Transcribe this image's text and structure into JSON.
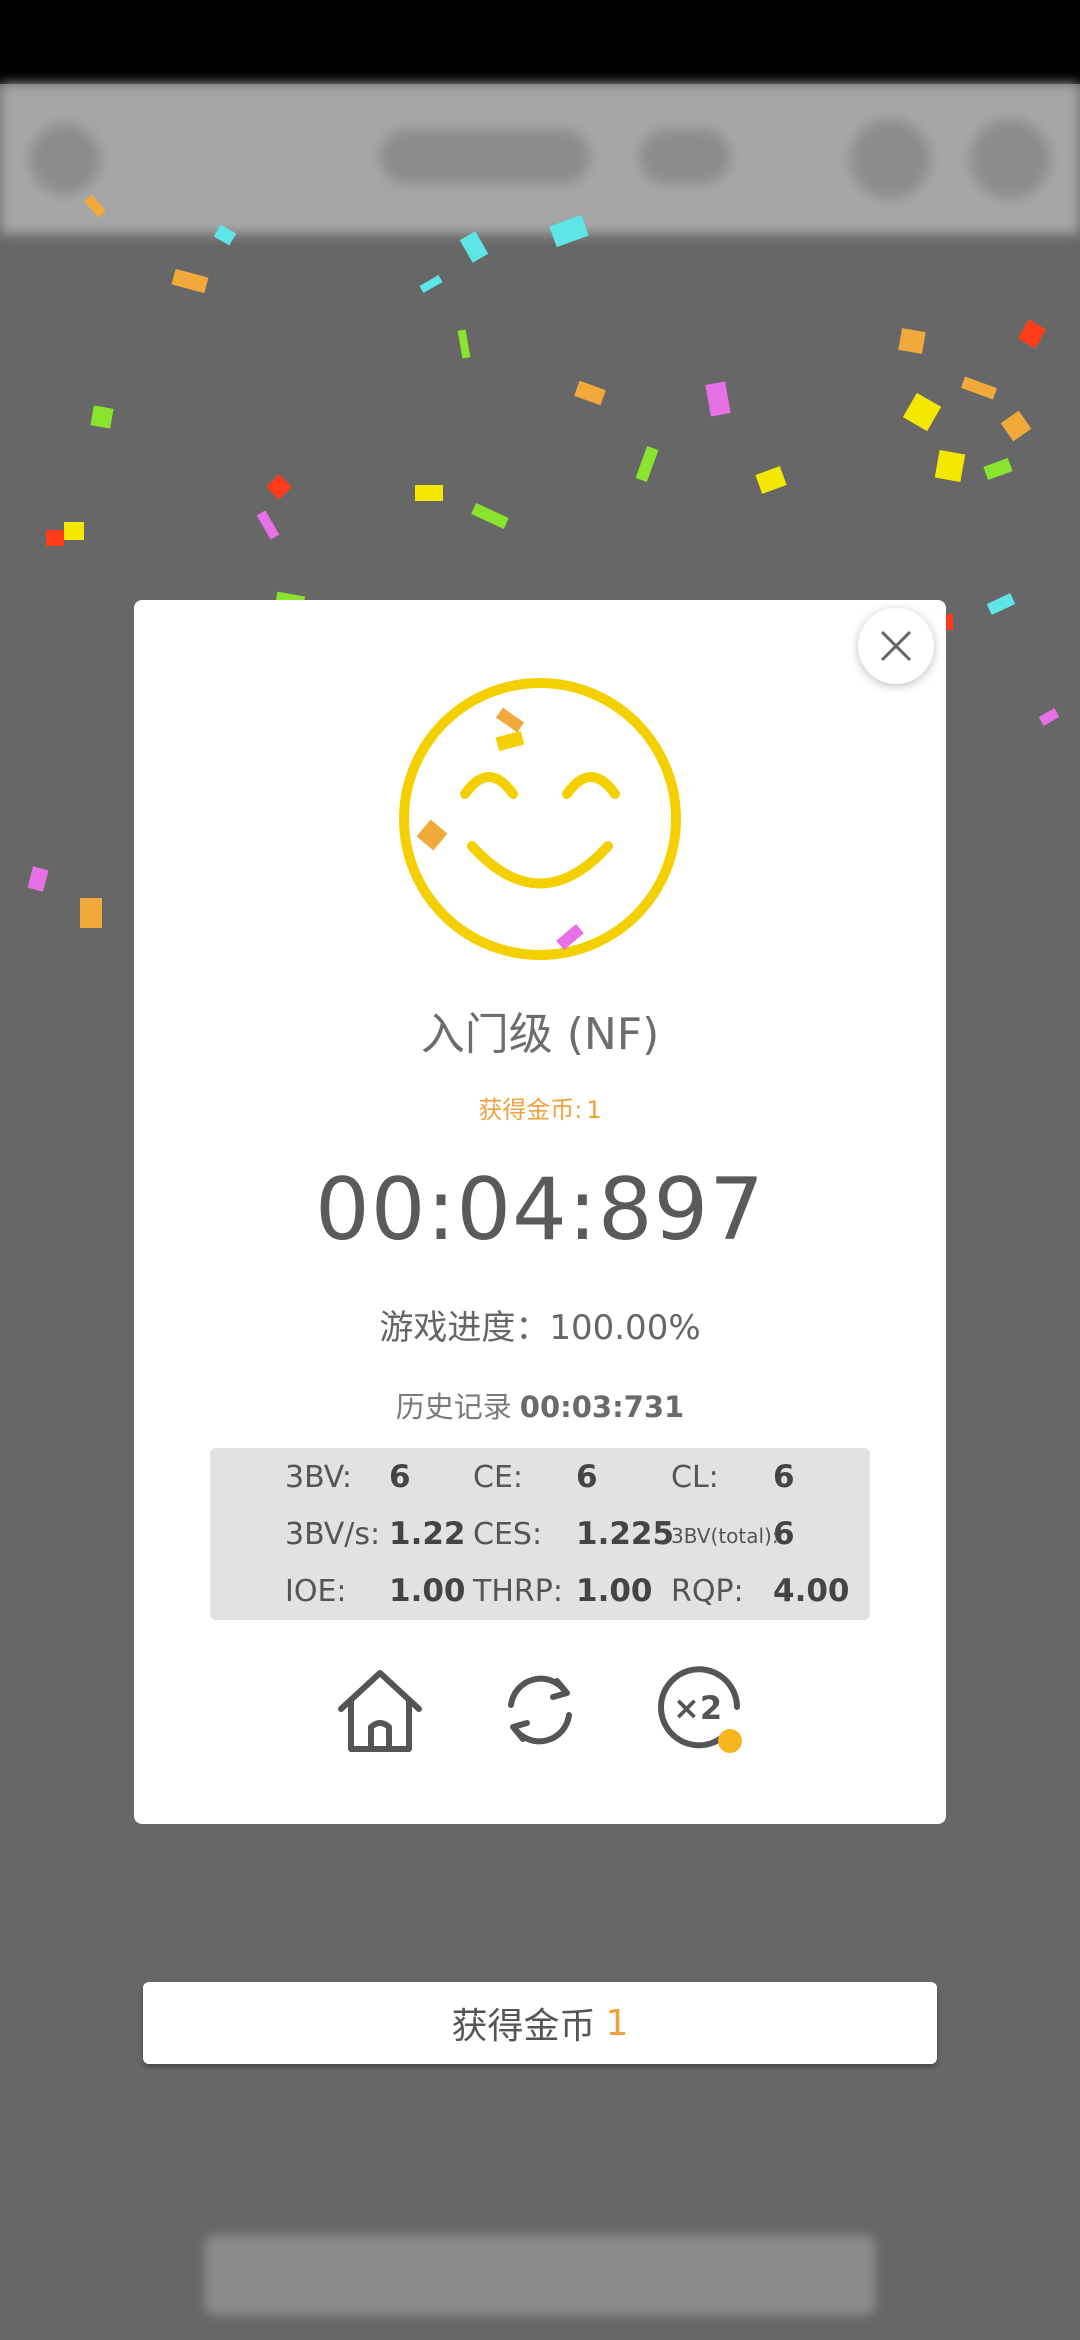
{
  "result": {
    "level_title": "入门级 (NF)",
    "coins_label": "获得金币:",
    "coins_value": "1",
    "time": "00:04:897",
    "progress_text": "游戏进度：100.00%",
    "history_label": "历史记录",
    "history_value": "00:03:731"
  },
  "stats": [
    {
      "label": "3BV:",
      "value": "6"
    },
    {
      "label": "CE:",
      "value": "6"
    },
    {
      "label": "CL:",
      "value": "6"
    },
    {
      "label": "3BV/s:",
      "value": "1.22"
    },
    {
      "label": "CES:",
      "value": "1.225"
    },
    {
      "label": "3BV(total):",
      "value": "6"
    },
    {
      "label": "IOE:",
      "value": "1.00"
    },
    {
      "label": "THRP:",
      "value": "1.00"
    },
    {
      "label": "RQP:",
      "value": "4.00"
    }
  ],
  "double_badge": "×2",
  "claim_button": {
    "label": "获得金币",
    "value": "1"
  },
  "icons": [
    "close-icon",
    "smiley-icon",
    "home-icon",
    "restart-icon",
    "double-coins-icon",
    "coin-icon"
  ],
  "colors": {
    "accent": "#f0a03c",
    "smiley": "#f5d000",
    "overlay": "#676767"
  }
}
